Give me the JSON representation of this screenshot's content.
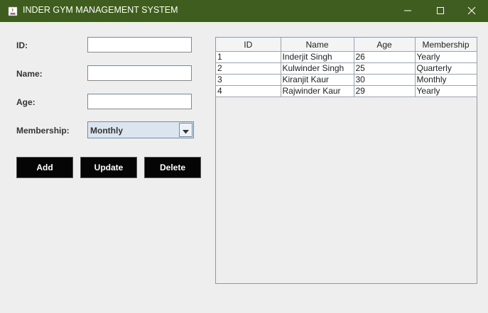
{
  "window": {
    "title": "INDER GYM MANAGEMENT SYSTEM",
    "titlebar_color": "#3f5d1e"
  },
  "form": {
    "id_label": "ID:",
    "name_label": "Name:",
    "age_label": "Age:",
    "membership_label": "Membership:",
    "id_value": "",
    "name_value": "",
    "age_value": "",
    "membership_selected": "Monthly"
  },
  "buttons": {
    "add": "Add",
    "update": "Update",
    "delete": "Delete"
  },
  "table": {
    "columns": [
      "ID",
      "Name",
      "Age",
      "Membership"
    ],
    "rows": [
      [
        "1",
        "Inderjit Singh",
        "26",
        "Yearly"
      ],
      [
        "2",
        "Kulwinder Singh",
        "25",
        "Quarterly"
      ],
      [
        "3",
        "Kiranjit Kaur",
        "30",
        "Monthly"
      ],
      [
        "4",
        "Rajwinder Kaur",
        "29",
        "Yearly"
      ]
    ]
  },
  "icons": {
    "app": "java-app-icon",
    "minimize": "minimize-icon",
    "maximize": "maximize-icon",
    "close": "close-icon",
    "dropdown": "chevron-down-icon"
  }
}
